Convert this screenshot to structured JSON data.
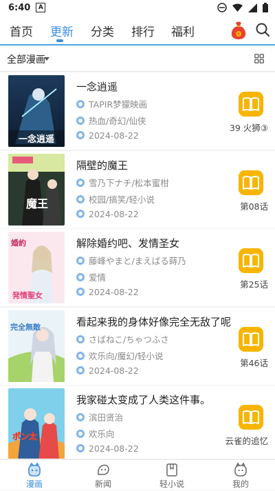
{
  "status_bar": {
    "time": "6:40",
    "notification_letter": "A"
  },
  "top_nav": {
    "tabs": [
      {
        "label": "首页"
      },
      {
        "label": "更新"
      },
      {
        "label": "分类"
      },
      {
        "label": "排行"
      },
      {
        "label": "福利"
      }
    ],
    "active_tab": "更新"
  },
  "filter": {
    "label": "全部漫画"
  },
  "comics": [
    {
      "title": "一念逍遥",
      "author": "TAPIR梦獴映画",
      "tags": "热血/奇幻/仙侠",
      "date": "2024-08-22",
      "chapter": "39 火狮③",
      "cover_text": "一念逍遥"
    },
    {
      "title": "隔壁的魔王",
      "author": "雪乃下ナチ/松本蜜柑",
      "tags": "校园/搞笑/轻小说",
      "date": "2024-08-22",
      "chapter": "第08话",
      "cover_text": "魔王"
    },
    {
      "title": "解除婚约吧、发情圣女",
      "author": "藤峰やまと/まえばる蒔乃",
      "tags": "爱情",
      "date": "2024-08-22",
      "chapter": "第25话",
      "cover_text": "発情聖女"
    },
    {
      "title": "看起来我的身体好像完全无敌了呢",
      "author": "さばねこ/ちゃつふさ",
      "tags": "欢乐向/魔幻/轻小说",
      "date": "2024-08-22",
      "chapter": "第46话",
      "cover_text": "完全無敵"
    },
    {
      "title": "我家碰太变成了人类这件事。",
      "author": "滨田贤治",
      "tags": "欢乐向",
      "date": "2024-08-22",
      "chapter": "云雀的追忆",
      "cover_text": "ポン太"
    }
  ],
  "bottom_nav": {
    "items": [
      {
        "label": "漫画"
      },
      {
        "label": "新闻"
      },
      {
        "label": "轻小说"
      },
      {
        "label": "我的"
      }
    ],
    "active": "漫画"
  },
  "colors": {
    "accent": "#3b8ee0",
    "read_button": "#f7b500",
    "meta_icon": "#7fb5ea"
  }
}
